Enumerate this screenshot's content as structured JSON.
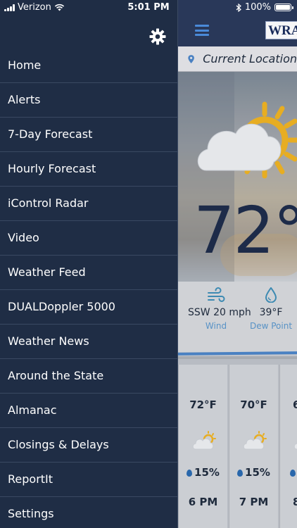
{
  "status_bar": {
    "carrier": "Verizon",
    "time": "5:01 PM",
    "battery": "100%"
  },
  "drawer": {
    "settings_icon": "gear-icon",
    "menu_items": [
      "Home",
      "Alerts",
      "7-Day Forecast",
      "Hourly Forecast",
      "iControl Radar",
      "Video",
      "Weather Feed",
      "DUALDoppler 5000",
      "Weather News",
      "Around the State",
      "Almanac",
      "Closings & Delays",
      "ReportIt",
      "Settings"
    ]
  },
  "app": {
    "logo_text": "WRAL",
    "location": "Current Location",
    "temperature": "72°",
    "wind": {
      "value": "SSW 20 mph",
      "label": "Wind"
    },
    "dew_point": {
      "value": "39°F",
      "label": "Dew Point"
    },
    "hourly": [
      {
        "temp": "72°F",
        "precip": "15%",
        "hour": "6 PM"
      },
      {
        "temp": "70°F",
        "precip": "15%",
        "hour": "7 PM"
      },
      {
        "temp": "6",
        "precip": "",
        "hour": "8"
      }
    ],
    "colors": {
      "accent": "#4c8fe0",
      "drawer_bg": "#1f2d45",
      "sun": "#f0b422"
    }
  }
}
